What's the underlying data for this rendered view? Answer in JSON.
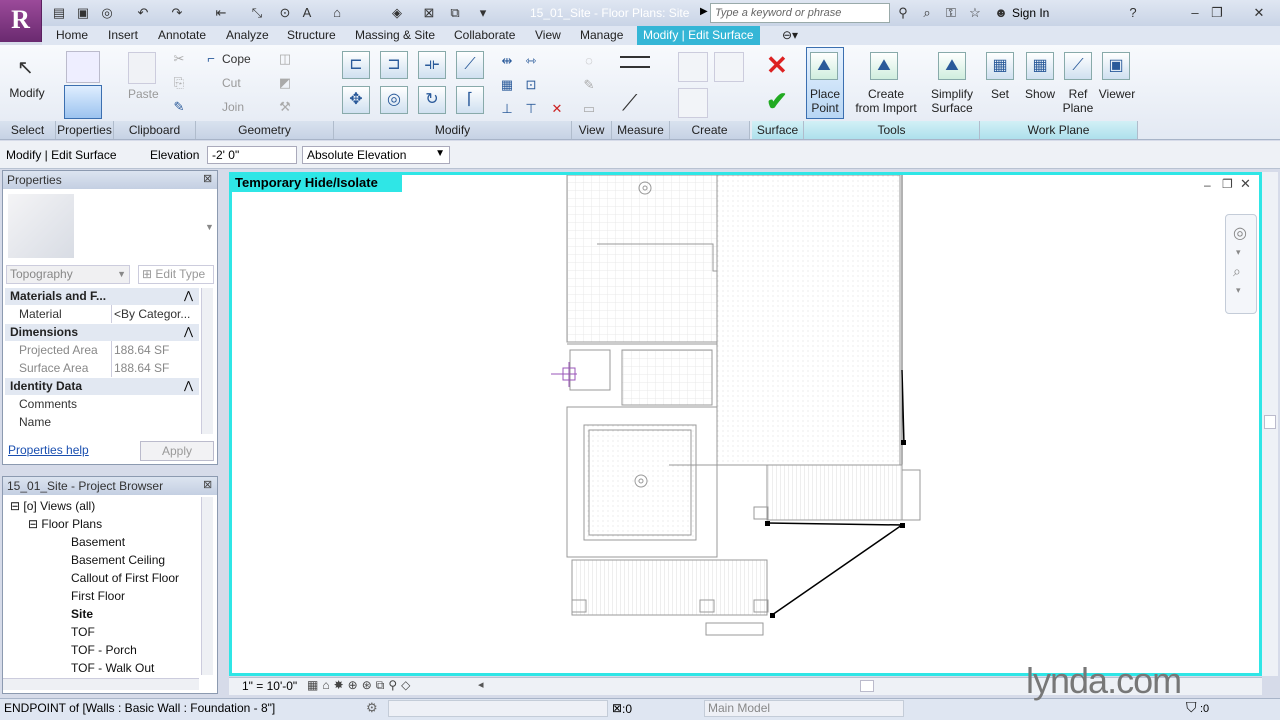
{
  "window": {
    "doc_title": "15_01_Site - Floor Plans: Site",
    "search_placeholder": "Type a keyword or phrase",
    "sign_in": "Sign In",
    "app_logo": "R"
  },
  "tabs": [
    "Home",
    "Insert",
    "Annotate",
    "Analyze",
    "Structure",
    "Massing & Site",
    "Collaborate",
    "View",
    "Manage",
    "Modify | Edit Surface"
  ],
  "ribbon": {
    "select": {
      "modify": "Modify",
      "label": "Select"
    },
    "properties": {
      "label": "Properties"
    },
    "clipboard": {
      "paste": "Paste",
      "label": "Clipboard"
    },
    "geometry": {
      "cope": "Cope",
      "cut": "Cut",
      "join": "Join",
      "label": "Geometry"
    },
    "modify": {
      "label": "Modify"
    },
    "view": {
      "label": "View"
    },
    "measure": {
      "label": "Measure"
    },
    "create": {
      "label": "Create"
    },
    "surface": {
      "label": "Surface"
    },
    "tools": {
      "place_point_1": "Place",
      "place_point_2": "Point",
      "create_import_1": "Create",
      "create_import_2": "from Import",
      "simplify_1": "Simplify",
      "simplify_2": "Surface",
      "label": "Tools"
    },
    "workplane": {
      "set": "Set",
      "show": "Show",
      "ref_1": "Ref",
      "ref_2": "Plane",
      "viewer": "Viewer",
      "label": "Work Plane"
    }
  },
  "optionsbar": {
    "context": "Modify | Edit Surface",
    "elevation_label": "Elevation",
    "elevation_value": "-2'  0\"",
    "elevation_mode": "Absolute Elevation"
  },
  "properties": {
    "title": "Properties",
    "type": "Topography",
    "edit_type": "Edit Type",
    "sections": {
      "materials": "Materials and F...",
      "dimensions": "Dimensions",
      "identity": "Identity Data"
    },
    "rows": {
      "material_k": "Material",
      "material_v": "<By Categor...",
      "proj_k": "Projected Area",
      "proj_v": "188.64 SF",
      "surf_k": "Surface Area",
      "surf_v": "188.64 SF",
      "comments_k": "Comments",
      "name_k": "Name"
    },
    "help": "Properties help",
    "apply": "Apply"
  },
  "browser": {
    "title": "15_01_Site - Project Browser",
    "views": "Views (all)",
    "floor_plans": "Floor Plans",
    "items": [
      "Basement",
      "Basement Ceiling",
      "Callout of First Floor",
      "First Floor",
      "Site",
      "TOF",
      "TOF - Porch",
      "TOF - Walk Out"
    ]
  },
  "canvas": {
    "isolate_label": "Temporary Hide/Isolate"
  },
  "viewbar": {
    "scale": "1\" = 10'-0\""
  },
  "status": {
    "text": "ENDPOINT  of [Walls : Basic Wall : Foundation - 8\"]",
    "count": ":0",
    "model": "Main Model",
    "filter": ":0"
  },
  "watermark": "lynda.com"
}
